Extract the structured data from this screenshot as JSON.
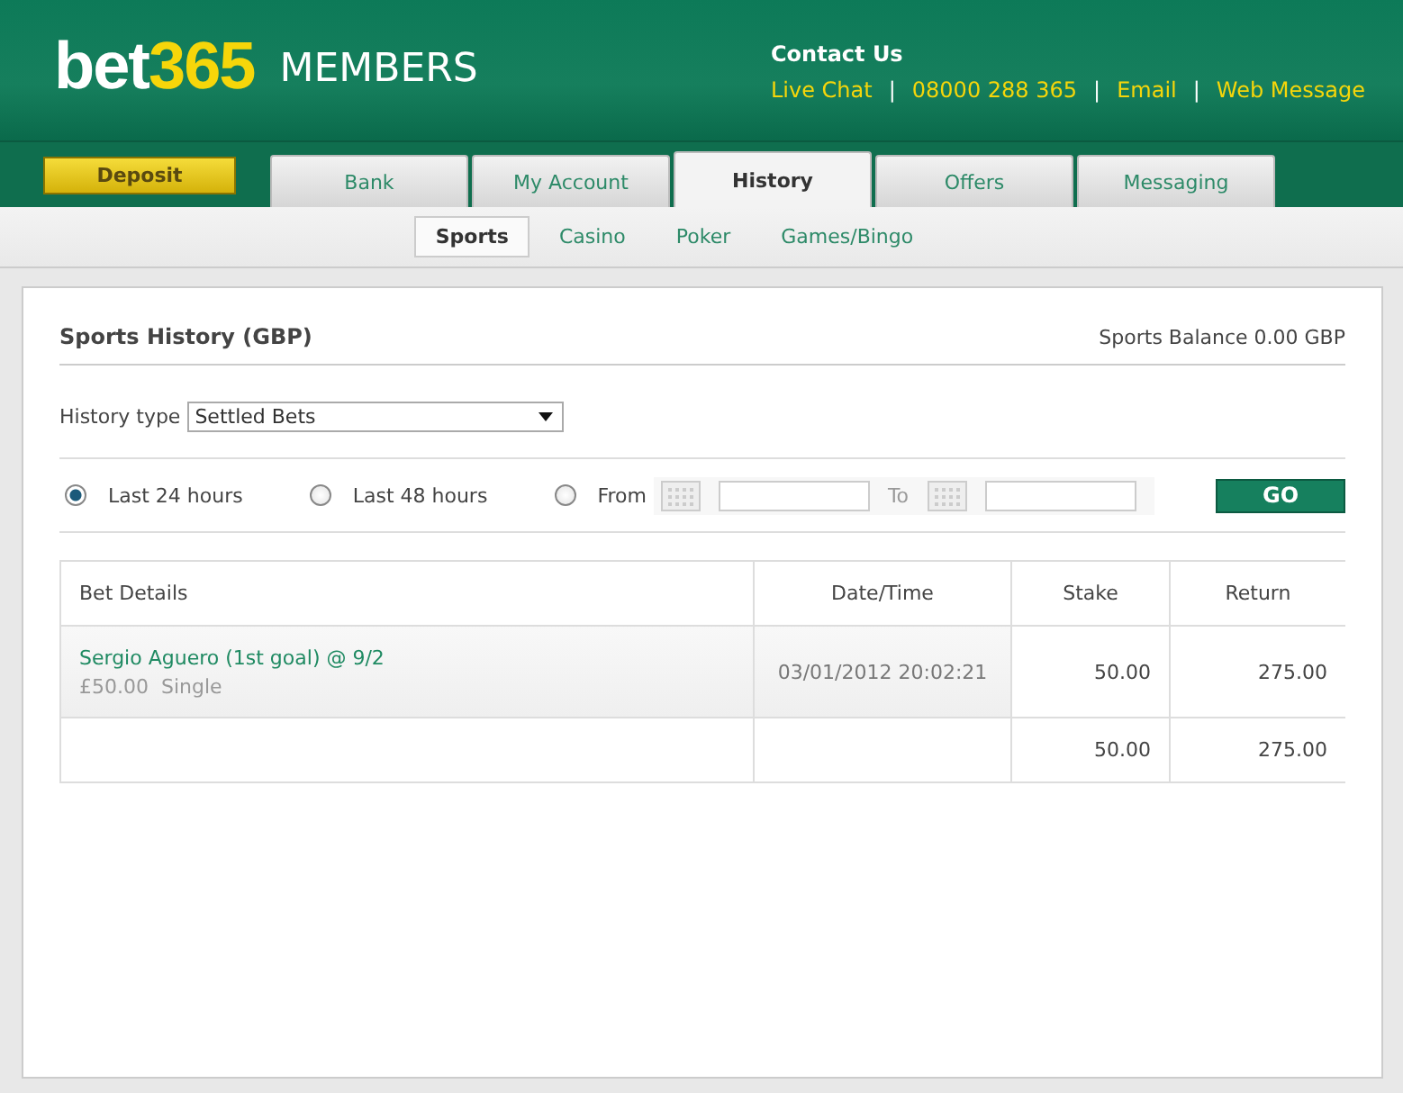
{
  "header": {
    "logo_main": "bet",
    "logo_accent": "365",
    "logo_suffix": "MEMBERS",
    "contact_title": "Contact Us",
    "contact_items": [
      {
        "kind": "link",
        "text": "Live Chat"
      },
      {
        "kind": "separator",
        "text": "|"
      },
      {
        "kind": "link",
        "text": "08000 288 365"
      },
      {
        "kind": "separator",
        "text": "|"
      },
      {
        "kind": "link",
        "text": "Email"
      },
      {
        "kind": "separator",
        "text": "|"
      },
      {
        "kind": "link",
        "text": "Web Message"
      }
    ]
  },
  "deposit_button": "Deposit",
  "tabs": [
    {
      "label": "Bank",
      "selected": false
    },
    {
      "label": "My Account",
      "selected": false
    },
    {
      "label": "History",
      "selected": true
    },
    {
      "label": "Offers",
      "selected": false
    },
    {
      "label": "Messaging",
      "selected": false
    }
  ],
  "subtabs": [
    {
      "label": "Sports",
      "selected": true
    },
    {
      "label": "Casino",
      "selected": false
    },
    {
      "label": "Poker",
      "selected": false
    },
    {
      "label": "Games/Bingo",
      "selected": false
    }
  ],
  "panel": {
    "title": "Sports History (GBP)",
    "balance": "Sports Balance 0.00 GBP",
    "history_type": {
      "label": "History type",
      "value": "Settled Bets"
    },
    "periods": [
      {
        "label": "Last 24 hours",
        "selected": true
      },
      {
        "label": "Last 48 hours",
        "selected": false
      },
      {
        "label": "From",
        "selected": false
      }
    ],
    "to_label": "To",
    "go_button": "GO",
    "table": {
      "columns": [
        "Bet Details",
        "Date/Time",
        "Stake",
        "Return"
      ],
      "rows": [
        {
          "kind": "bet",
          "selection": "Sergio Aguero (1st goal) @ 9/2",
          "stake_text": "£50.00",
          "bet_type": "Single",
          "datetime": "03/01/2012 20:02:21",
          "stake": "50.00",
          "return": "275.00"
        },
        {
          "kind": "total",
          "stake": "50.00",
          "return": "275.00"
        }
      ]
    }
  }
}
